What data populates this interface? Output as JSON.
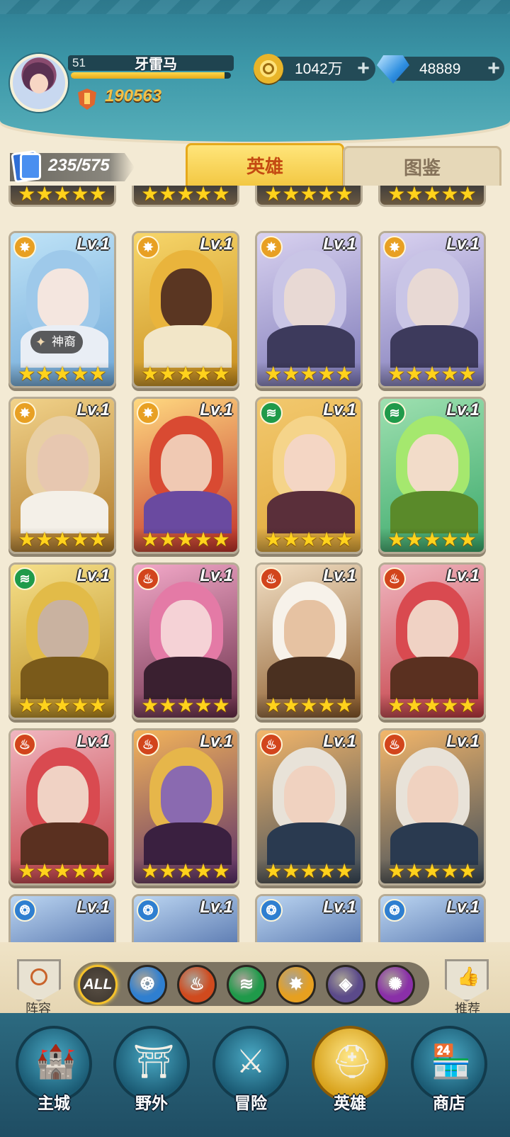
{
  "player": {
    "level": "51",
    "name": "牙雷马",
    "power": "190563",
    "xp_fraction": 0.96
  },
  "resources": {
    "gold": "1042万",
    "diamonds": "48889"
  },
  "hero_count": "235/575",
  "tabs": {
    "heroes": "英雄",
    "codex": "图鉴"
  },
  "cards": [
    {
      "level": "Lv.1",
      "element": "light",
      "stars": 5,
      "tag": "神裔",
      "palette": "frost"
    },
    {
      "level": "Lv.1",
      "element": "light",
      "stars": 5,
      "palette": "gold"
    },
    {
      "level": "Lv.1",
      "element": "light",
      "stars": 5,
      "palette": "silver"
    },
    {
      "level": "Lv.1",
      "element": "light",
      "stars": 5,
      "palette": "silver"
    },
    {
      "level": "Lv.1",
      "element": "light",
      "stars": 5,
      "palette": "king"
    },
    {
      "level": "Lv.1",
      "element": "light",
      "stars": 5,
      "palette": "redhair"
    },
    {
      "level": "Lv.1",
      "element": "nature",
      "stars": 5,
      "palette": "blonde"
    },
    {
      "level": "Lv.1",
      "element": "nature",
      "stars": 5,
      "palette": "green"
    },
    {
      "level": "Lv.1",
      "element": "nature",
      "stars": 5,
      "palette": "goldarmor"
    },
    {
      "level": "Lv.1",
      "element": "fire",
      "stars": 5,
      "palette": "witch"
    },
    {
      "level": "Lv.1",
      "element": "fire",
      "stars": 5,
      "palette": "elder"
    },
    {
      "level": "Lv.1",
      "element": "fire",
      "stars": 5,
      "palette": "skull"
    },
    {
      "level": "Lv.1",
      "element": "fire",
      "stars": 5,
      "palette": "skull"
    },
    {
      "level": "Lv.1",
      "element": "fire",
      "stars": 5,
      "palette": "dark"
    },
    {
      "level": "Lv.1",
      "element": "fire",
      "stars": 5,
      "palette": "robot"
    },
    {
      "level": "Lv.1",
      "element": "fire",
      "stars": 5,
      "palette": "robot"
    }
  ],
  "partial_row": [
    {
      "level": "Lv.1",
      "element": "water"
    },
    {
      "level": "Lv.1",
      "element": "water"
    },
    {
      "level": "Lv.1",
      "element": "water"
    },
    {
      "level": "Lv.1",
      "element": "water"
    }
  ],
  "filters": [
    {
      "id": "all",
      "label": "ALL"
    },
    {
      "id": "water",
      "icon": "water-element-icon",
      "color": "#2f7fd0"
    },
    {
      "id": "fire",
      "icon": "fire-element-icon",
      "color": "#d04a1e"
    },
    {
      "id": "nature",
      "icon": "nature-element-icon",
      "color": "#1f9a4a"
    },
    {
      "id": "light",
      "icon": "light-element-icon",
      "color": "#e6a020"
    },
    {
      "id": "dark",
      "icon": "dark-element-icon",
      "color": "#5b4a8a"
    },
    {
      "id": "void",
      "icon": "void-element-icon",
      "color": "#8a2fa8"
    }
  ],
  "side_buttons": {
    "lineup": "阵容",
    "recommend": "推荐"
  },
  "nav": [
    {
      "label": "主城",
      "icon": "castle-icon"
    },
    {
      "label": "野外",
      "icon": "portal-icon"
    },
    {
      "label": "冒险",
      "icon": "sword-icon"
    },
    {
      "label": "英雄",
      "icon": "helmet-icon",
      "active": true
    },
    {
      "label": "商店",
      "icon": "shop-icon"
    }
  ],
  "element_colors": {
    "light": "#e8a023",
    "nature": "#1f9a4a",
    "fire": "#d2451c",
    "water": "#2f7fd0"
  }
}
